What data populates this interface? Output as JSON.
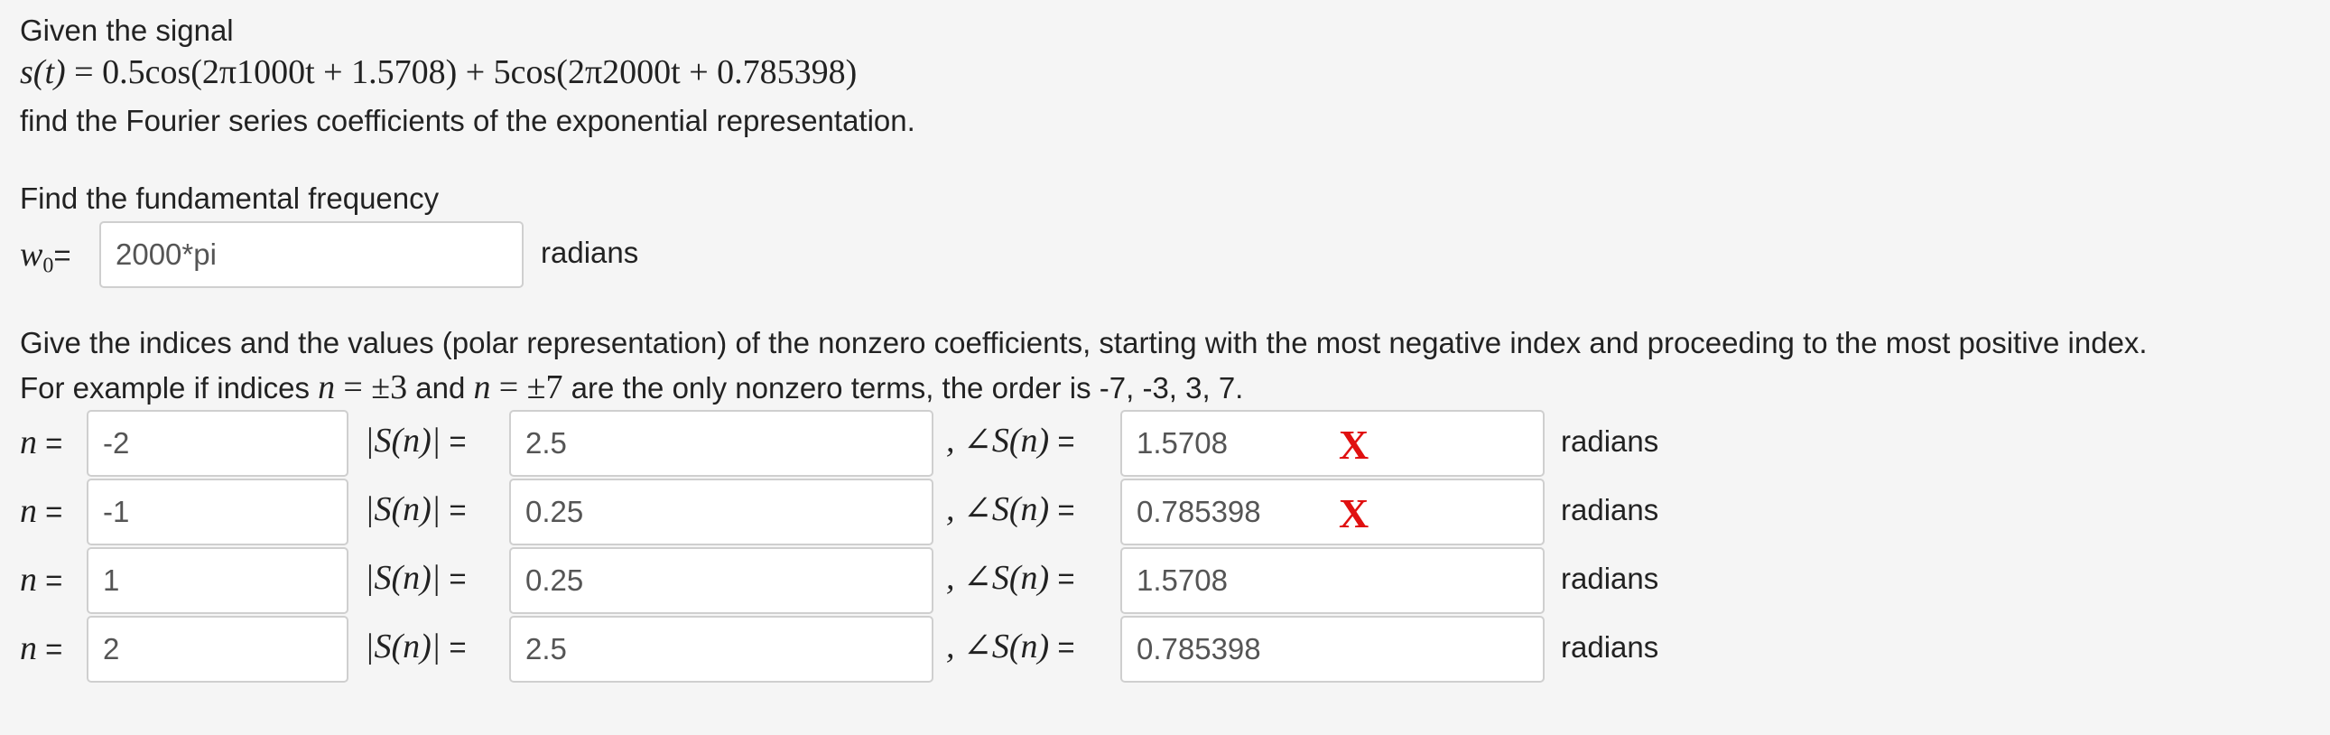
{
  "problem": {
    "intro": "Given the signal",
    "signal_lhs": "s(t)",
    "signal_rhs": "= 0.5cos(2π1000t + 1.5708) + 5cos(2π2000t + 0.785398)",
    "task": "find the Fourier series coefficients of the exponential representation."
  },
  "fundamental": {
    "prompt": "Find the fundamental frequency",
    "label_w": "w",
    "label_sub": "0",
    "label_eq": "=",
    "value": "2000*pi",
    "units": "radians"
  },
  "coefficients": {
    "instructions": "Give the indices and the values (polar representation) of the nonzero coefficients, starting with the most negative index and proceeding to the most positive index.",
    "example_prefix": "For example if indices",
    "example_n1": "n",
    "example_eq1": "= ±3",
    "example_and": "and",
    "example_n2": "n",
    "example_eq2": "= ±7",
    "example_suffix": "are the only nonzero terms, the order is -7, -3, 3, 7.",
    "n_label": "n",
    "mag_label": "|S(n)|",
    "angle_label": ", ∠S(n)",
    "eq": "=",
    "units": "radians",
    "rows": [
      {
        "n": "-2",
        "magnitude": "2.5",
        "angle": "1.5708",
        "mark": "X"
      },
      {
        "n": "-1",
        "magnitude": "0.25",
        "angle": "0.785398",
        "mark": "X"
      },
      {
        "n": "1",
        "magnitude": "0.25",
        "angle": "1.5708",
        "mark": ""
      },
      {
        "n": "2",
        "magnitude": "2.5",
        "angle": "0.785398",
        "mark": ""
      }
    ]
  }
}
